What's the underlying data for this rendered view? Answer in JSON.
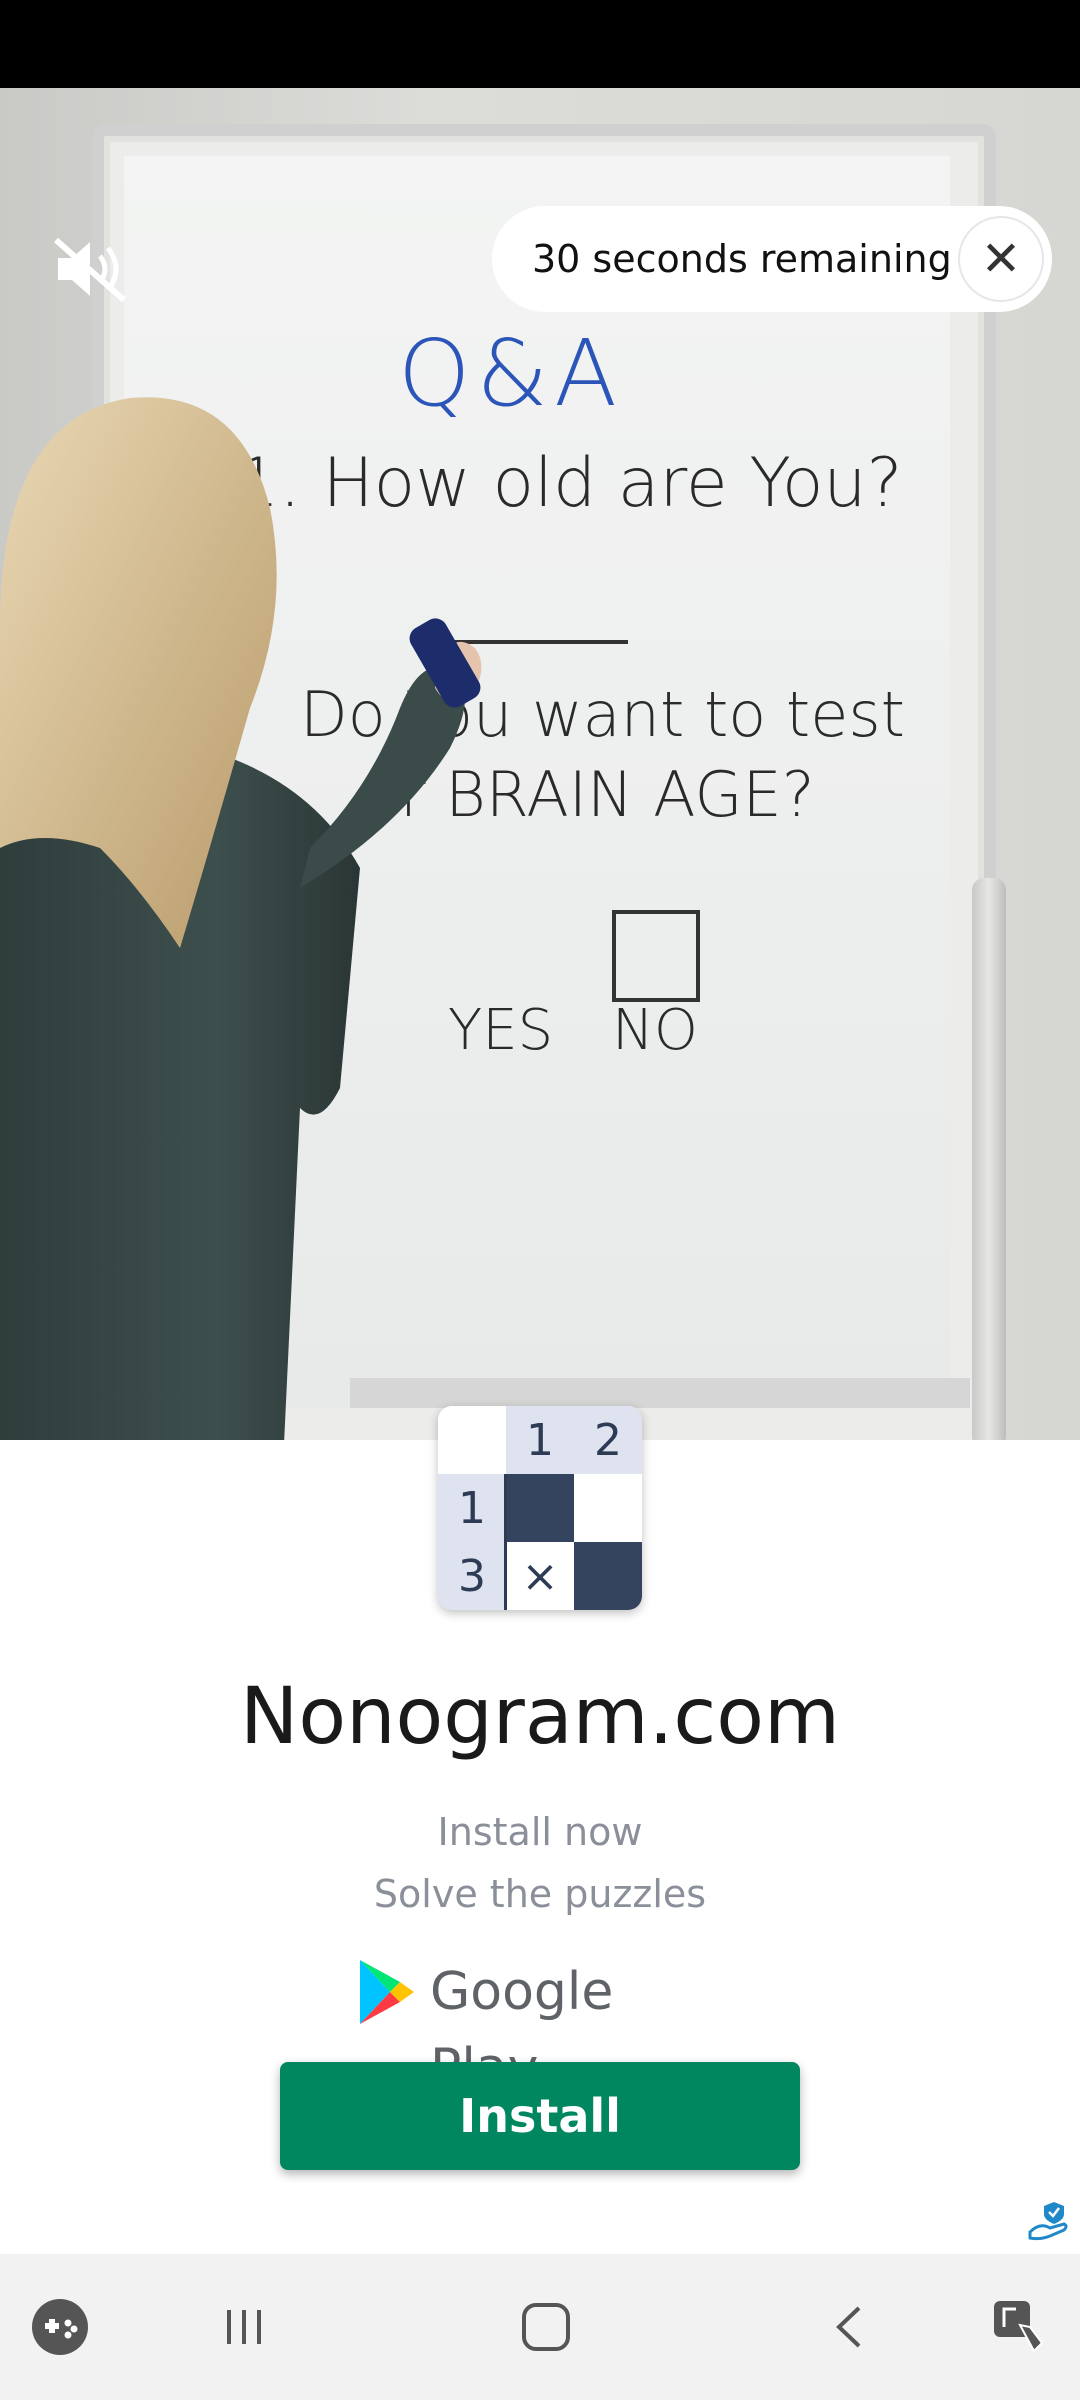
{
  "ad": {
    "timer_text": "30 seconds remaining",
    "close_label": "✕"
  },
  "whiteboard": {
    "title": "Q&A",
    "q1": "1. How old are You?",
    "q2_line1": "Do You want to test",
    "q2_line2": "r BRAIN AGE?",
    "yes": "YES",
    "no": "NO"
  },
  "logo": {
    "col_clues": [
      "1",
      "2"
    ],
    "row_clues": [
      "1",
      "3"
    ],
    "x_mark": "×"
  },
  "app": {
    "name": "Nonogram.com",
    "tagline1": "Install now",
    "tagline2": "Solve the puzzles",
    "store": "Google Play",
    "install_label": "Install"
  },
  "colors": {
    "install": "#01875f",
    "grid_dark": "#34445f",
    "title_blue": "#2b55b8"
  },
  "icons": {
    "mute": "volume-muted-icon",
    "close": "close-icon",
    "play": "google-play-icon",
    "adchoices": "adchoices-icon",
    "game": "game-launcher-icon",
    "recents": "recents-icon",
    "home": "home-icon",
    "back": "back-icon",
    "accessibility": "accessibility-icon"
  }
}
